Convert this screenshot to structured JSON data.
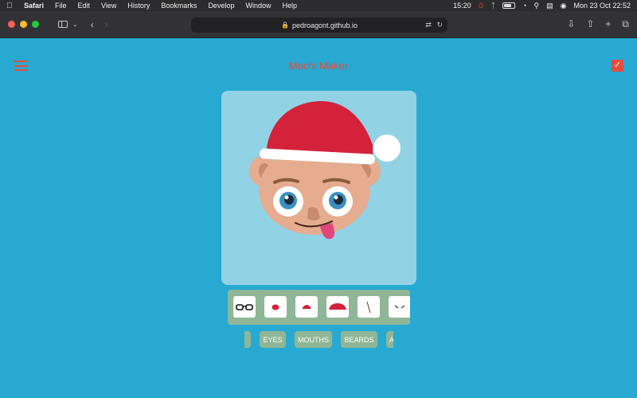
{
  "menubar": {
    "app": "Safari",
    "items": [
      "File",
      "Edit",
      "View",
      "History",
      "Bookmarks",
      "Develop",
      "Window",
      "Help"
    ],
    "clock_short": "15:20",
    "battery": "62",
    "datetime": "Mon 23 Oct  22:52"
  },
  "browser": {
    "url": "pedroagont.github.io"
  },
  "app": {
    "title": "Mochi Maker"
  },
  "colors": {
    "page_bg": "#27a9d2",
    "accent": "#e74c3c",
    "canvas_bg": "#92d2e5",
    "picker_bg": "#8fb696",
    "hat_red": "#d4223b",
    "skin": "#e5ac8f"
  },
  "picker": {
    "items": [
      "glasses-icon",
      "red-nose-icon",
      "santa-hat-icon",
      "red-cap-icon",
      "scar-icon",
      "brows-icon"
    ]
  },
  "tabs": [
    "S",
    "EYES",
    "MOUTHS",
    "BEARDS",
    "A"
  ]
}
